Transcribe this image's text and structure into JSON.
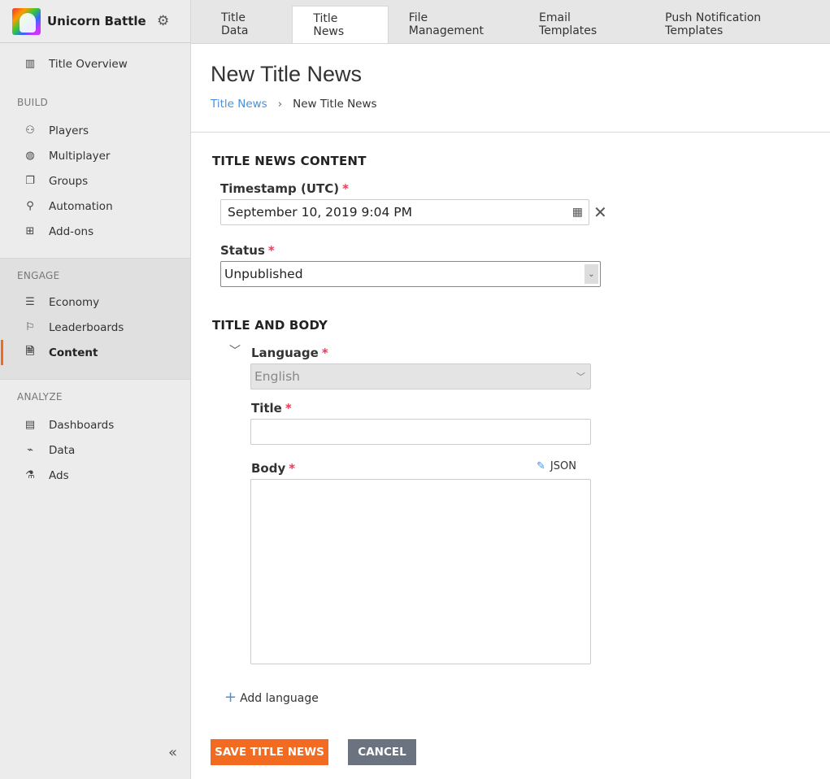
{
  "app": {
    "name": "Unicorn Battle"
  },
  "sidebar": {
    "overview": "Title Overview",
    "sections": [
      {
        "label": "BUILD",
        "items": [
          "Players",
          "Multiplayer",
          "Groups",
          "Automation",
          "Add-ons"
        ]
      },
      {
        "label": "ENGAGE",
        "items": [
          "Economy",
          "Leaderboards",
          "Content"
        ]
      },
      {
        "label": "ANALYZE",
        "items": [
          "Dashboards",
          "Data",
          "Ads"
        ]
      }
    ],
    "active_item": "Content"
  },
  "tabs": [
    "Title Data",
    "Title News",
    "File Management",
    "Email Templates",
    "Push Notification Templates"
  ],
  "active_tab": "Title News",
  "header": {
    "title": "New Title News",
    "breadcrumb": [
      "Title News",
      "New Title News"
    ]
  },
  "form": {
    "section1": "TITLE NEWS CONTENT",
    "timestamp_label": "Timestamp (UTC)",
    "timestamp_value": "September 10, 2019 9:04 PM",
    "status_label": "Status",
    "status_value": "Unpublished",
    "section2": "TITLE AND BODY",
    "language_label": "Language",
    "language_value": "English",
    "title_label": "Title",
    "title_value": "",
    "body_label": "Body",
    "body_value": "",
    "json_label": "JSON",
    "add_language": "Add language",
    "required": "*"
  },
  "buttons": {
    "save": "SAVE TITLE NEWS",
    "cancel": "CANCEL"
  },
  "colors": {
    "accent": "#f26b21",
    "link": "#4a90d9",
    "cancel": "#6b7280"
  }
}
